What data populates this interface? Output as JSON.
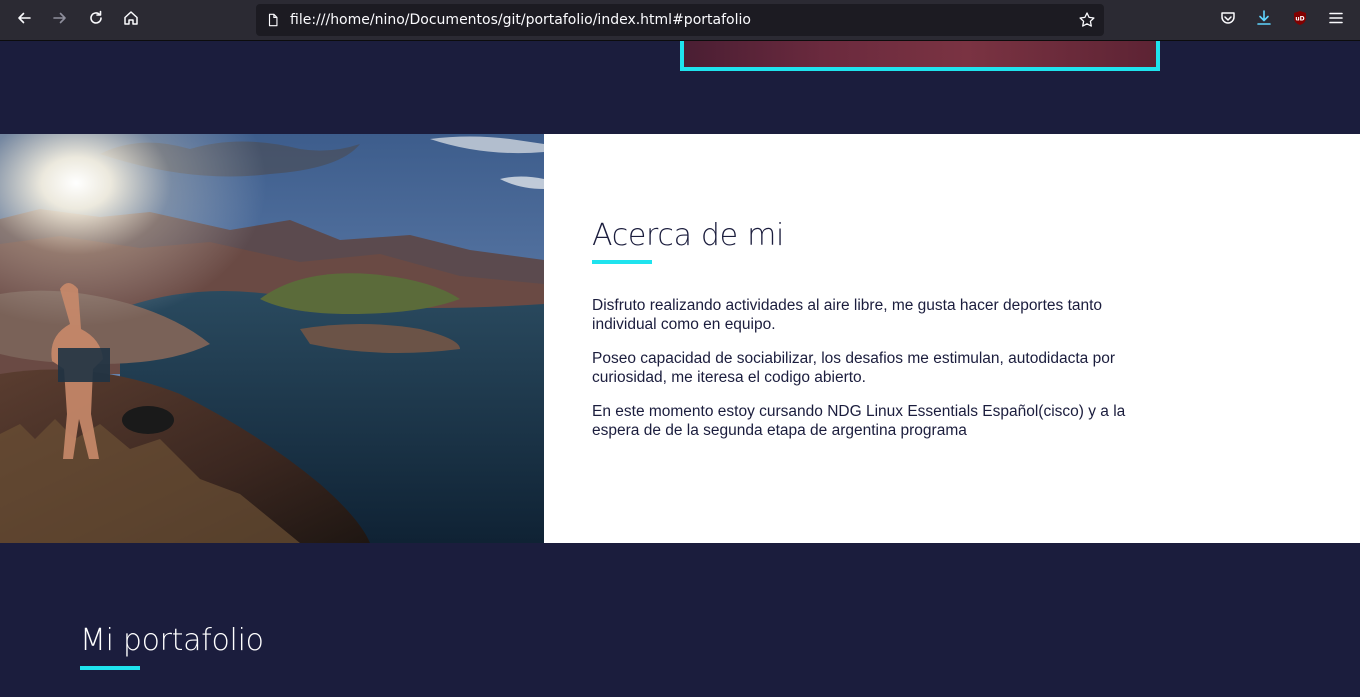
{
  "browser": {
    "url": "file:///home/nino/Documentos/git/portafolio/index.html#portafolio",
    "icons": {
      "back": "back-arrow-icon",
      "forward": "forward-arrow-icon",
      "reload": "reload-icon",
      "home": "home-icon",
      "page": "page-icon",
      "bookmark": "star-icon",
      "pocket": "pocket-icon",
      "downloads": "download-icon",
      "ublock": "ublock-origin-icon",
      "menu": "hamburger-menu-icon"
    },
    "ublock_badge": "uD"
  },
  "about": {
    "title": "Acerca de mi",
    "paragraphs": [
      "Disfruto realizando actividades al aire libre, me gusta hacer deportes tanto individual como en equipo.",
      "Poseo capacidad de sociabilizar, los desafios me estimulan, autodidacta por curiosidad, me iteresa el codigo abierto.",
      "En este momento estoy cursando NDG Linux Essentials Español(cisco) y a la espera de de la segunda etapa de argentina programa"
    ]
  },
  "portfolio": {
    "title": "Mi portafolio"
  },
  "colors": {
    "navy": "#1b1d3d",
    "accent": "#1fe3ee",
    "white": "#ffffff",
    "toolbar": "#2b2a33"
  }
}
